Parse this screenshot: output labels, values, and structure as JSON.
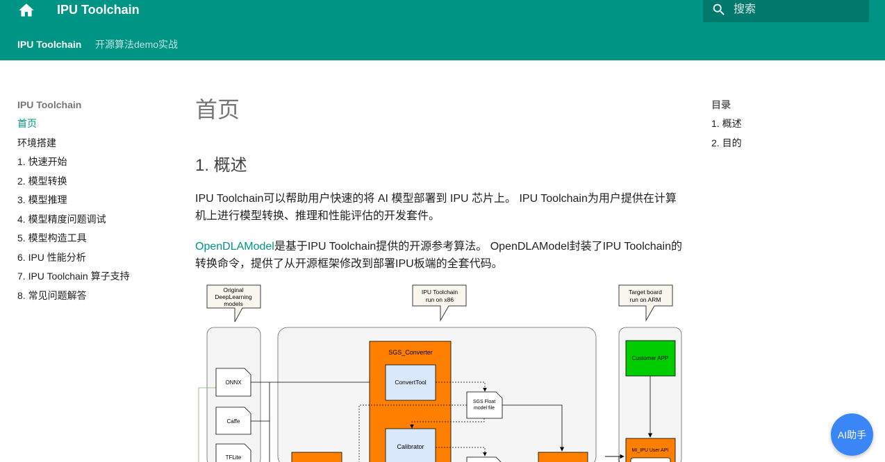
{
  "header": {
    "site_title": "IPU Toolchain",
    "search_placeholder": "搜索",
    "tabs": [
      {
        "label": "IPU Toolchain"
      },
      {
        "label": "开源算法demo实战"
      }
    ]
  },
  "sidebar": {
    "title": "IPU Toolchain",
    "items": [
      {
        "label": "首页"
      },
      {
        "label": "环境搭建"
      },
      {
        "label": "1. 快速开始"
      },
      {
        "label": "2. 模型转换"
      },
      {
        "label": "3. 模型推理"
      },
      {
        "label": "4. 模型精度问题调试"
      },
      {
        "label": "5. 模型构造工具"
      },
      {
        "label": "6. IPU 性能分析"
      },
      {
        "label": "7. IPU Toolchain 算子支持"
      },
      {
        "label": "8. 常见问题解答"
      }
    ]
  },
  "toc": {
    "title": "目录",
    "items": [
      {
        "label": "1. 概述"
      },
      {
        "label": "2. 目的"
      }
    ]
  },
  "content": {
    "page_title": "首页",
    "section_title": "1. 概述",
    "para1": "IPU Toolchain可以帮助用户快速的将 AI 模型部署到 IPU 芯片上。 IPU Toolchain为用户提供在计算机上进行模型转换、推理和性能评估的开发套件。",
    "para2_link": "OpenDLAModel",
    "para2_rest": "是基于IPU Toolchain提供的开源参考算法。 OpenDLAModel封装了IPU Toolchain的转换命令，提供了从开源框架修改到部署IPU板端的全套代码。"
  },
  "diagram": {
    "callout_left": [
      "Original",
      "DeepLearning",
      "models"
    ],
    "callout_mid": [
      "IPU Toolchain",
      "run on x86"
    ],
    "callout_right": [
      "Target board",
      "run on ARM"
    ],
    "models": [
      "ONNX",
      "Caffe",
      "TFLite"
    ],
    "converter_title": "SGS_Converter",
    "convert_tool": "ConvertTool",
    "calibrator": "Calibrator",
    "float_model": [
      "SGS Float",
      "model file"
    ],
    "customer_app": "Customer APP",
    "user_api": "MI_IPU User API",
    "colors": {
      "orange": "#ff8000",
      "green": "#00cc00",
      "lightblue": "#dae8fc",
      "note": "#f9f7ed"
    }
  },
  "ai_assistant": {
    "label": "AI助手"
  }
}
